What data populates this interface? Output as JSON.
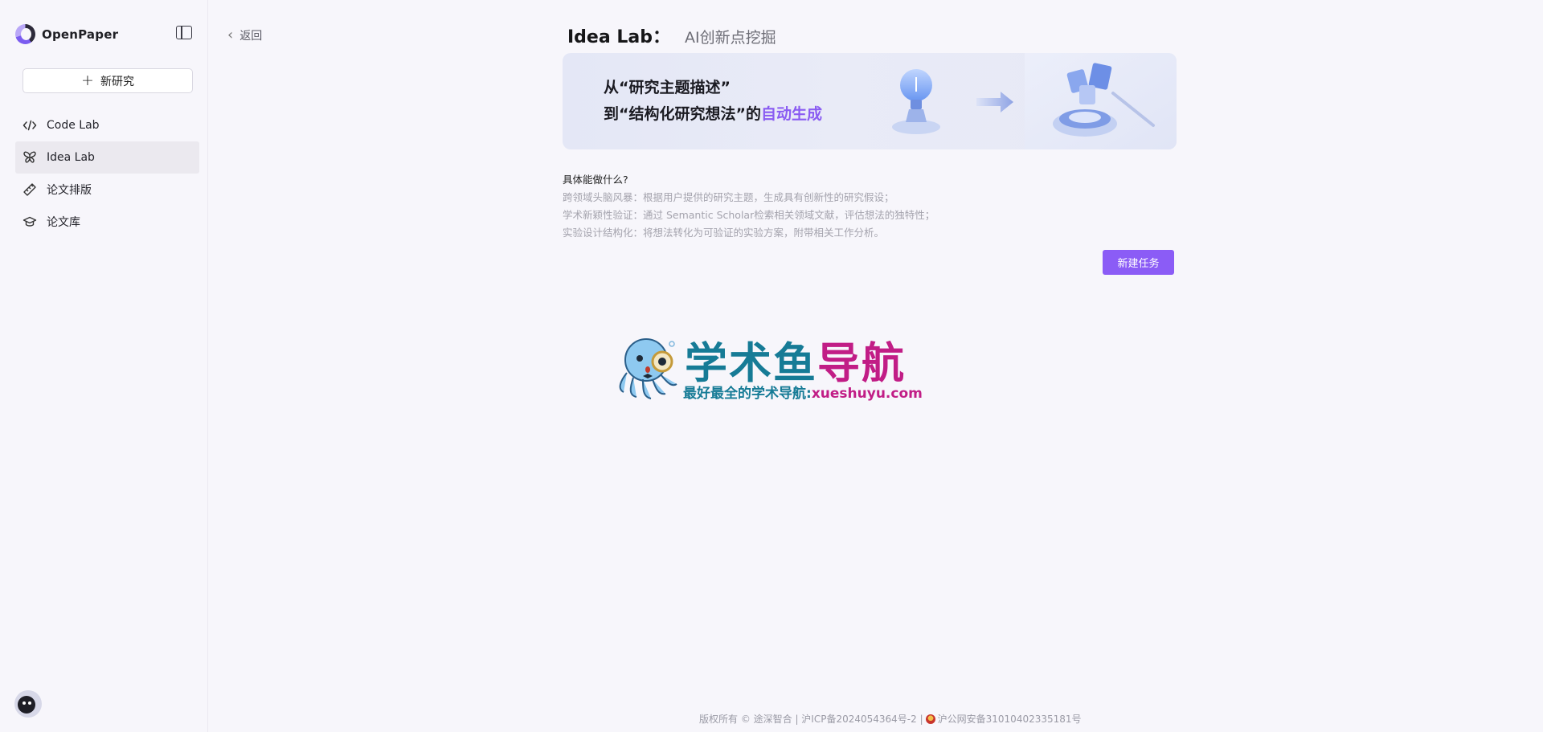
{
  "brand": {
    "name": "OpenPaper"
  },
  "sidebar": {
    "new_button_label": "新研究",
    "items": [
      {
        "label": "Code Lab",
        "icon": "code-icon",
        "active": false
      },
      {
        "label": "Idea Lab",
        "icon": "butterfly-icon",
        "active": true
      },
      {
        "label": "论文排版",
        "icon": "ruler-icon",
        "active": false
      },
      {
        "label": "论文库",
        "icon": "graduation-cap-icon",
        "active": false
      }
    ]
  },
  "header": {
    "back_label": "返回",
    "title": "Idea Lab：",
    "subtitle": "AI创新点挖掘"
  },
  "banner": {
    "line1": "从“研究主题描述”",
    "line2_prefix": "到“结构化研究想法”的",
    "line2_highlight": "自动生成"
  },
  "features": {
    "title": "具体能做什么?",
    "items": [
      "跨领域头脑风暴：根据用户提供的研究主题，生成具有创新性的研究假设；",
      "学术新颖性验证：通过 Semantic Scholar检索相关领域文献，评估想法的独特性；",
      "实验设计结构化：将想法转化为可验证的实验方案，附带相关工作分析。"
    ]
  },
  "actions": {
    "create_task_label": "新建任务"
  },
  "watermark": {
    "title_part1": "学术鱼",
    "title_part2": "导航",
    "subtitle_part1": "最好最全的学术导航:",
    "subtitle_part2": "xueshuyu.com"
  },
  "footer": {
    "copyright": "版权所有 © 途深智合 | 沪ICP备2024054364号-2 |",
    "police": "沪公网安备31010402335181号"
  },
  "colors": {
    "accent": "#8b5cf6",
    "watermark_teal": "#167b96",
    "watermark_magenta": "#c11d86"
  }
}
